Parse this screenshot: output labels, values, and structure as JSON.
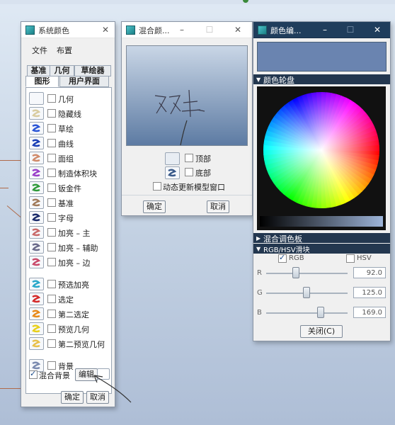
{
  "colors": {
    "blend_top": "#c9d6e6",
    "blend_bottom": "#5d7ba3",
    "editor_preview": "#6a84b0"
  },
  "system_colors": {
    "title": "系统颜色",
    "menu": [
      "文件",
      "布置"
    ],
    "tabs_top": [
      "基准",
      "几何",
      "草绘器"
    ],
    "tabs_bottom": [
      "图形",
      "用户界面"
    ],
    "items": [
      {
        "label": "几何",
        "icon": "blank-swatch-icon",
        "color": "#ffffff"
      },
      {
        "label": "隐藏线",
        "icon": "curve-swatch-icon",
        "color": "#d9cca0"
      },
      {
        "label": "草绘",
        "icon": "curve-swatch-icon",
        "color": "#2a55d6"
      },
      {
        "label": "曲线",
        "icon": "curve-swatch-icon",
        "color": "#1b3fb5"
      },
      {
        "label": "面组",
        "icon": "curve-swatch-icon",
        "color": "#d08a6a"
      },
      {
        "label": "制造体积块",
        "icon": "curve-swatch-icon",
        "color": "#9a3fc9"
      },
      {
        "label": "钣金件",
        "icon": "curve-swatch-icon",
        "color": "#2f9a3a"
      },
      {
        "label": "基准",
        "icon": "curve-swatch-icon",
        "color": "#a07a5a"
      },
      {
        "label": "字母",
        "icon": "curve-swatch-icon",
        "color": "#1a2a6a"
      },
      {
        "label": "加亮 – 主",
        "icon": "curve-swatch-icon",
        "color": "#c96a6a"
      },
      {
        "label": "加亮 – 辅助",
        "icon": "curve-swatch-icon",
        "color": "#6a6a8a"
      },
      {
        "label": "加亮 – 边",
        "icon": "curve-swatch-icon",
        "color": "#c94a6a"
      },
      {
        "label": "预选加亮",
        "icon": "curve-swatch-icon",
        "color": "#2aa8c9"
      },
      {
        "label": "选定",
        "icon": "curve-swatch-icon",
        "color": "#d42a2a"
      },
      {
        "label": "第二选定",
        "icon": "curve-swatch-icon",
        "color": "#e88a1a"
      },
      {
        "label": "预览几何",
        "icon": "curve-swatch-icon",
        "color": "#e8d01a"
      },
      {
        "label": "第二预览几何",
        "icon": "curve-swatch-icon",
        "color": "#e8c04a"
      },
      {
        "label": "背景",
        "icon": "curve-swatch-icon",
        "color": "#7a8ab0"
      }
    ],
    "blend_label": "混合背景",
    "edit_button": "编辑",
    "ok": "确定",
    "cancel": "取消"
  },
  "blend_colors": {
    "title": "混合颜...",
    "top_label": "顶部",
    "bottom_label": "底部",
    "dynamic_label": "动态更新模型窗口",
    "ok": "确定",
    "cancel": "取消"
  },
  "color_editor": {
    "title": "颜色编...",
    "wheel_section": "颜色轮盘",
    "mixing_section": "混合调色板",
    "slider_section": "RGB/HSV滑块",
    "rgb_label": "RGB",
    "hsv_label": "HSV",
    "r_label": "R",
    "g_label": "G",
    "b_label": "B",
    "r_value": "92.0",
    "g_value": "125.0",
    "b_value": "169.0",
    "r": 92,
    "g": 125,
    "b": 169,
    "close": "关闭(C)"
  }
}
